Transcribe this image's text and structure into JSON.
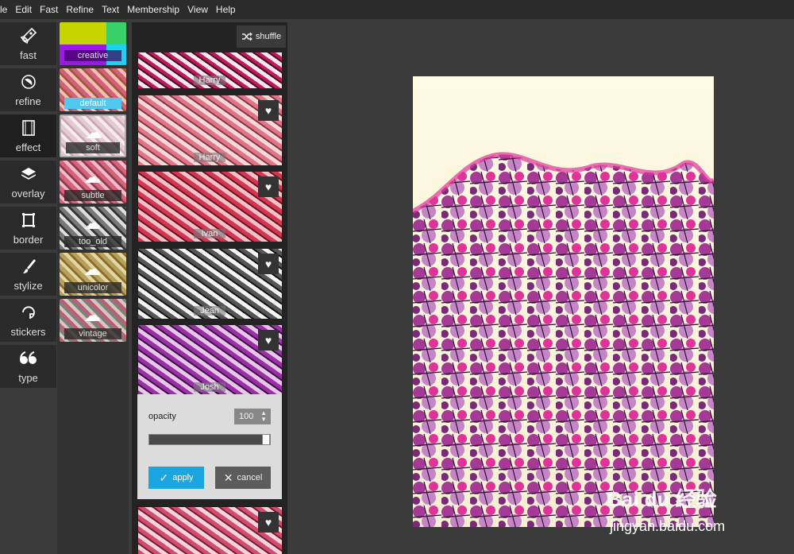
{
  "menu": [
    "le",
    "Edit",
    "Fast",
    "Refine",
    "Text",
    "Membership",
    "View",
    "Help"
  ],
  "tools": [
    "fast",
    "refine",
    "effect",
    "overlay",
    "border",
    "stylize",
    "stickers",
    "type"
  ],
  "presets": [
    "creative",
    "default",
    "soft",
    "subtle",
    "too_old",
    "unicolor",
    "vintage"
  ],
  "filters": {
    "shuffle_label": "shuffle",
    "items": [
      "Harry",
      "Ivan",
      "Jean",
      "Josh"
    ],
    "top_label": "Harry"
  },
  "panel": {
    "opacity_label": "opacity",
    "opacity_value": "100",
    "apply_label": "apply",
    "cancel_label": "cancel"
  },
  "watermark": {
    "brand": "Bai du 经验",
    "url": "jingyan.baidu.com"
  },
  "colors": {
    "accent": "#1aa6e0",
    "bg": "#3b3b3b"
  }
}
